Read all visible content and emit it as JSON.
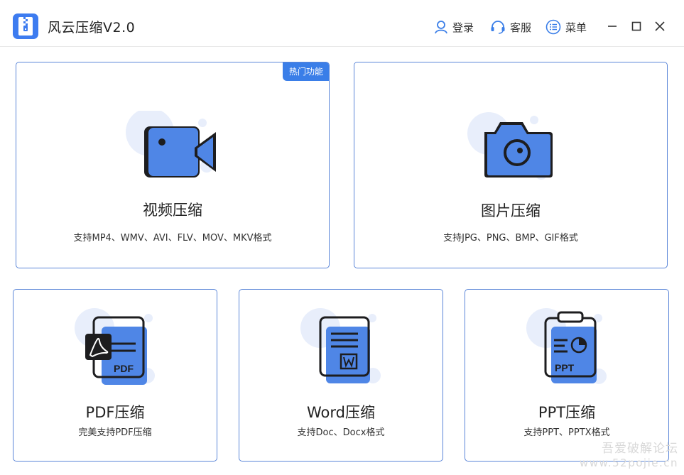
{
  "app": {
    "title": "风云压缩V2.0"
  },
  "header": {
    "login_label": "登录",
    "service_label": "客服",
    "menu_label": "菜单"
  },
  "colors": {
    "accent": "#3a7ee8",
    "icon_fill": "#4f86e6",
    "icon_bg": "#e8eefb",
    "border": "#5b86d8"
  },
  "cards": [
    {
      "id": "video",
      "icon": "video-camera-icon",
      "badge": "热门功能",
      "title": "视频压缩",
      "desc": "支持MP4、WMV、AVI、FLV、MOV、MKV格式"
    },
    {
      "id": "image",
      "icon": "camera-icon",
      "title": "图片压缩",
      "desc": "支持JPG、PNG、BMP、GIF格式"
    },
    {
      "id": "pdf",
      "icon": "pdf-file-icon",
      "title": "PDF压缩",
      "desc": "完美支持PDF压缩"
    },
    {
      "id": "word",
      "icon": "word-file-icon",
      "title": "Word压缩",
      "desc": "支持Doc、Docx格式"
    },
    {
      "id": "ppt",
      "icon": "ppt-file-icon",
      "title": "PPT压缩",
      "desc": "支持PPT、PPTX格式"
    }
  ],
  "watermark": {
    "line1": "吾爱破解论坛",
    "line2": "www.52pojie.cn"
  }
}
